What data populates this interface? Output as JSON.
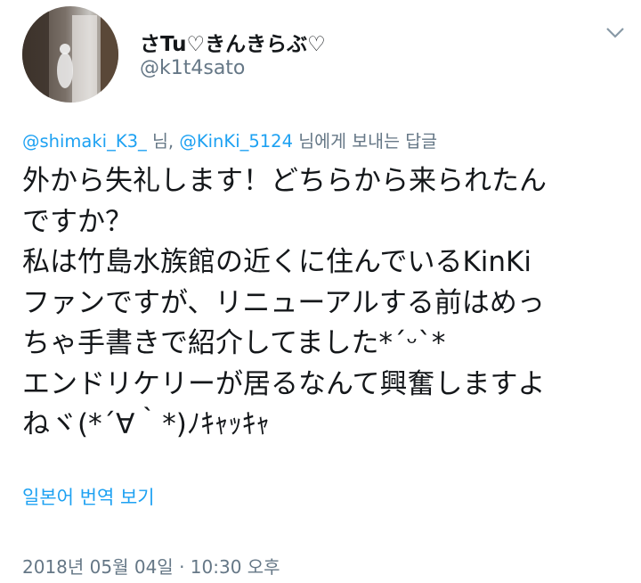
{
  "user": {
    "display_name": "さTu♡きんきらぶ♡",
    "handle": "@k1t4sato",
    "avatar_icon": "avatar-photo"
  },
  "reply": {
    "mention_1": "@shimaki_K3_",
    "sep_1": " 님, ",
    "mention_2": "@KinKi_5124",
    "suffix": " 님에게 보내는 답글"
  },
  "tweet": {
    "lines": [
      "外から失礼します！どちらから来られたん",
      "ですか？",
      "私は竹島水族館の近くに住んでいるKinKi",
      "ファンですが、リニューアルする前はめっ",
      "ちゃ手書きで紹介してました*´ᵕ`*",
      "エンドリケリーが居るなんて興奮しますよ",
      "ねヾ(*´∀｀*)ﾉｷｬｯｷｬ"
    ]
  },
  "translate_label": "일본어 번역 보기",
  "timestamp": "2018년 05월 04일 · 10:30 오후",
  "colors": {
    "link": "#1da1f2",
    "secondary_text": "#657786",
    "primary_text": "#14171a"
  }
}
